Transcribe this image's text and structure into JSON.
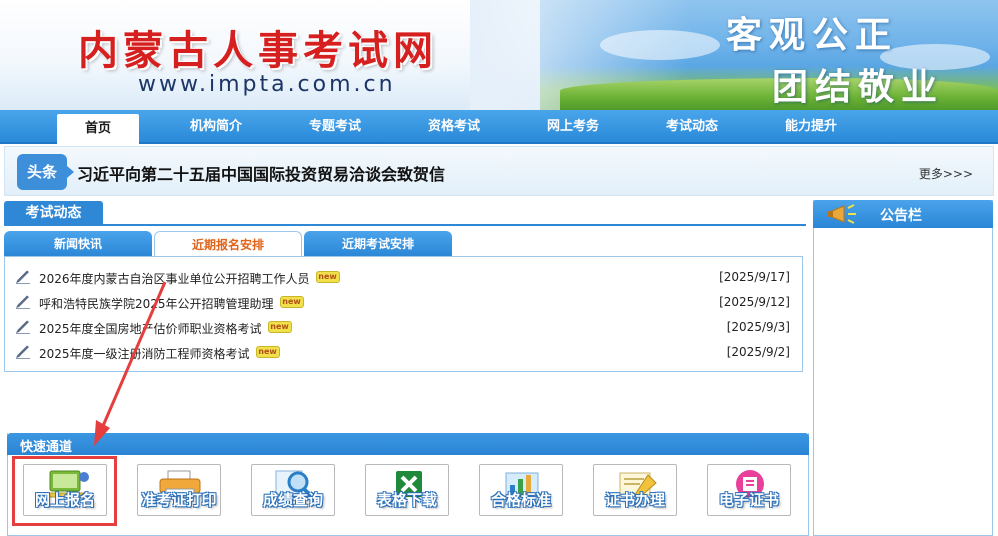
{
  "header": {
    "site_title": "内蒙古人事考试网",
    "site_url": "www.impta.com.cn",
    "slogan_line1": "客观公正",
    "slogan_line2": "团结敬业"
  },
  "nav": {
    "items": [
      {
        "label": "首页",
        "active": true
      },
      {
        "label": "机构简介",
        "active": false
      },
      {
        "label": "专题考试",
        "active": false
      },
      {
        "label": "资格考试",
        "active": false
      },
      {
        "label": "网上考务",
        "active": false
      },
      {
        "label": "考试动态",
        "active": false
      },
      {
        "label": "能力提升",
        "active": false
      }
    ]
  },
  "headline": {
    "tag": "头条",
    "text": "习近平向第二十五届中国国际投资贸易洽谈会致贺信",
    "more": "更多>>>"
  },
  "exam_news": {
    "title": "考试动态",
    "tabs": [
      {
        "label": "新闻快讯",
        "active": false
      },
      {
        "label": "近期报名安排",
        "active": true
      },
      {
        "label": "近期考试安排",
        "active": false
      }
    ],
    "items": [
      {
        "title": "2026年度内蒙古自治区事业单位公开招聘工作人员",
        "date": "[2025/9/17]",
        "badge": "new"
      },
      {
        "title": "呼和浩特民族学院2025年公开招聘管理助理",
        "date": "[2025/9/12]",
        "badge": "new"
      },
      {
        "title": "2025年度全国房地产估价师职业资格考试",
        "date": "[2025/9/3]",
        "badge": "new"
      },
      {
        "title": "2025年度一级注册消防工程师资格考试",
        "date": "[2025/9/2]",
        "badge": "new"
      }
    ]
  },
  "quick_access": {
    "title": "快速通道",
    "buttons": [
      {
        "label": "网上报名",
        "icon": "laptop-icon",
        "highlighted": true
      },
      {
        "label": "准考证打印",
        "icon": "printer-icon",
        "highlighted": false
      },
      {
        "label": "成绩查询",
        "icon": "magnifier-icon",
        "highlighted": false
      },
      {
        "label": "表格下载",
        "icon": "excel-icon",
        "highlighted": false
      },
      {
        "label": "合格标准",
        "icon": "bar-chart-icon",
        "highlighted": false
      },
      {
        "label": "证书办理",
        "icon": "certificate-icon",
        "highlighted": false
      },
      {
        "label": "电子证书",
        "icon": "pdf-icon",
        "highlighted": false
      }
    ]
  },
  "notice": {
    "title": "公告栏",
    "icon": "megaphone-icon"
  },
  "colors": {
    "nav_blue": "#2a8ad9",
    "title_red": "#d61f1f",
    "active_tab_orange": "#e0651a",
    "annotation_red": "#e53e3e"
  }
}
